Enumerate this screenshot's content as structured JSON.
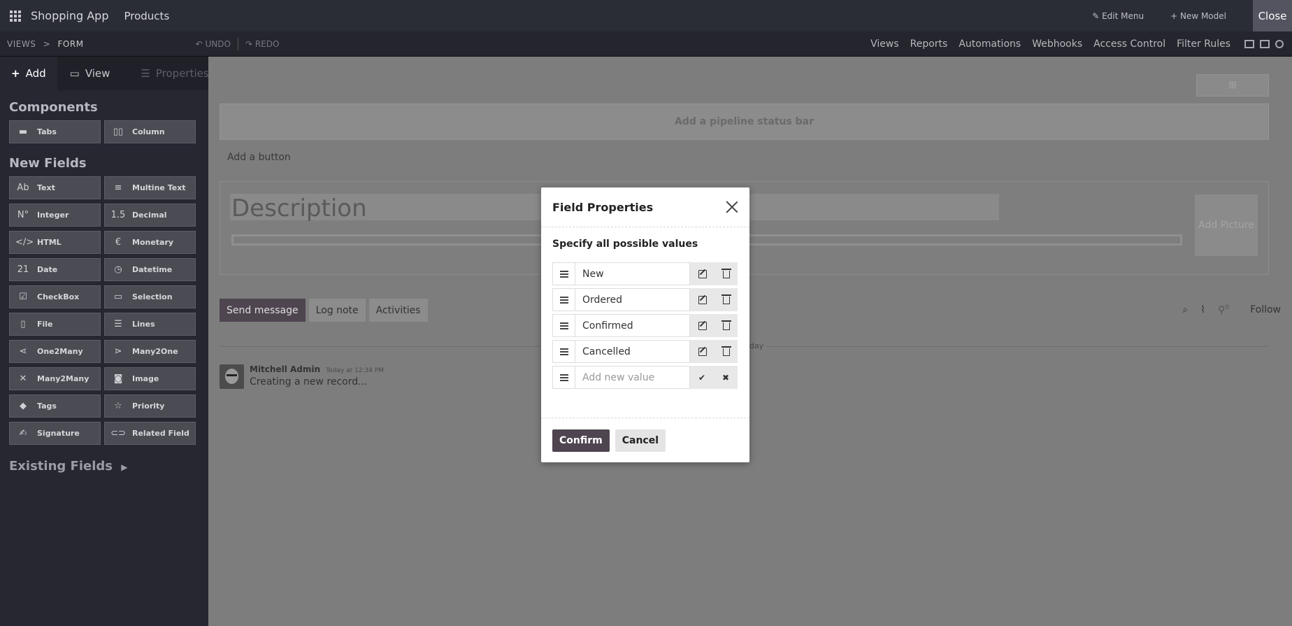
{
  "topbar": {
    "app_name": "Shopping App",
    "menu": "Products",
    "edit_menu": "Edit Menu",
    "new_model": "New Model",
    "close": "Close"
  },
  "subbar": {
    "breadcrumb_root": "VIEWS",
    "breadcrumb_sep": ">",
    "breadcrumb_current": "FORM",
    "undo": "UNDO",
    "redo": "REDO",
    "nav": [
      "Views",
      "Reports",
      "Automations",
      "Webhooks",
      "Access Control",
      "Filter Rules"
    ]
  },
  "sidebar": {
    "tabs": [
      "Add",
      "View",
      "Properties"
    ],
    "components_title": "Components",
    "components": [
      {
        "label": "Tabs",
        "icon": "tabs-icon"
      },
      {
        "label": "Column",
        "icon": "column-icon"
      }
    ],
    "new_fields_title": "New Fields",
    "fields": [
      {
        "label": "Text",
        "icon": "text-icon",
        "glyph": "Ab"
      },
      {
        "label": "Multine Text",
        "icon": "multiline-icon",
        "glyph": "≡"
      },
      {
        "label": "Integer",
        "icon": "integer-icon",
        "glyph": "N°"
      },
      {
        "label": "Decimal",
        "icon": "decimal-icon",
        "glyph": "1.5"
      },
      {
        "label": "HTML",
        "icon": "html-icon",
        "glyph": "</>"
      },
      {
        "label": "Monetary",
        "icon": "monetary-icon",
        "glyph": "€"
      },
      {
        "label": "Date",
        "icon": "date-icon",
        "glyph": "21"
      },
      {
        "label": "Datetime",
        "icon": "datetime-icon",
        "glyph": "◷"
      },
      {
        "label": "CheckBox",
        "icon": "checkbox-icon",
        "glyph": "☑"
      },
      {
        "label": "Selection",
        "icon": "selection-icon",
        "glyph": "▭"
      },
      {
        "label": "File",
        "icon": "file-icon",
        "glyph": "▯"
      },
      {
        "label": "Lines",
        "icon": "lines-icon",
        "glyph": "☰"
      },
      {
        "label": "One2Many",
        "icon": "one2many-icon",
        "glyph": "⋖"
      },
      {
        "label": "Many2One",
        "icon": "many2one-icon",
        "glyph": "⋗"
      },
      {
        "label": "Many2Many",
        "icon": "many2many-icon",
        "glyph": "✕"
      },
      {
        "label": "Image",
        "icon": "image-icon",
        "glyph": "◙"
      },
      {
        "label": "Tags",
        "icon": "tags-icon",
        "glyph": "◆"
      },
      {
        "label": "Priority",
        "icon": "priority-icon",
        "glyph": "☆"
      },
      {
        "label": "Signature",
        "icon": "signature-icon",
        "glyph": "✍"
      },
      {
        "label": "Related Field",
        "icon": "related-field-icon",
        "glyph": "⊂⊃"
      }
    ],
    "existing_title": "Existing Fields"
  },
  "form": {
    "pipeline": "Add a pipeline status bar",
    "add_button": "Add a button",
    "title_placeholder": "Description",
    "picture": "Add Picture",
    "chatter_buttons": [
      "Send message",
      "Log note",
      "Activities"
    ],
    "follow": "Follow",
    "followers_count": "0",
    "date_sep": "day",
    "message": {
      "author": "Mitchell Admin",
      "time": "Today at 12:34 PM",
      "body": "Creating a new record..."
    }
  },
  "modal": {
    "title": "Field Properties",
    "subtitle": "Specify all possible values",
    "values": [
      "New",
      "Ordered",
      "Confirmed",
      "Cancelled"
    ],
    "new_value_placeholder": "Add new value",
    "confirm": "Confirm",
    "cancel": "Cancel"
  },
  "colors": {
    "primary": "#4f4550",
    "sidebar": "#262731",
    "overlay": "#7d7d7d"
  }
}
